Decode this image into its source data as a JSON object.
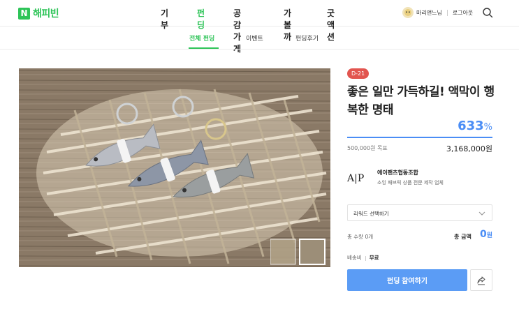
{
  "brand": {
    "logo_letter": "N",
    "name": "해피빈",
    "accent": "#2ec458"
  },
  "nav": {
    "items": [
      "기부",
      "펀딩",
      "공감가게",
      "가볼까",
      "굿액션"
    ],
    "active": "펀딩"
  },
  "user": {
    "name": "마리앤느님",
    "logout": "로그아웃",
    "search_icon": "search-icon"
  },
  "subnav": {
    "tabs": [
      "전체 펀딩",
      "이벤트",
      "펀딩후기"
    ],
    "active": "전체 펀딩"
  },
  "product": {
    "dday": "D-21",
    "title": "좋은 일만 가득하길! 액막이 행복한 명태",
    "percent_value": "633",
    "percent_sign": "%",
    "progress_fraction": 1.0,
    "goal": "500,000원 목표",
    "raised": "3,168,000원"
  },
  "maker": {
    "name": "에이팬츠협동조합",
    "desc": "소잉 패브릭 상품 전문 제작 업체",
    "logo_text": "A|P"
  },
  "reward": {
    "select_label": "리워드 선택하기"
  },
  "summary": {
    "qty": "총 수량 0개",
    "total_label": "총 금액",
    "total_value": "0",
    "total_unit": "원"
  },
  "shipping": {
    "label": "배송비",
    "value": "무료"
  },
  "actions": {
    "fund_label": "펀딩 참여하기"
  },
  "colors": {
    "blue": "#4a8df5",
    "button_blue": "#5b9cf5",
    "dday_red": "#e2554f"
  }
}
